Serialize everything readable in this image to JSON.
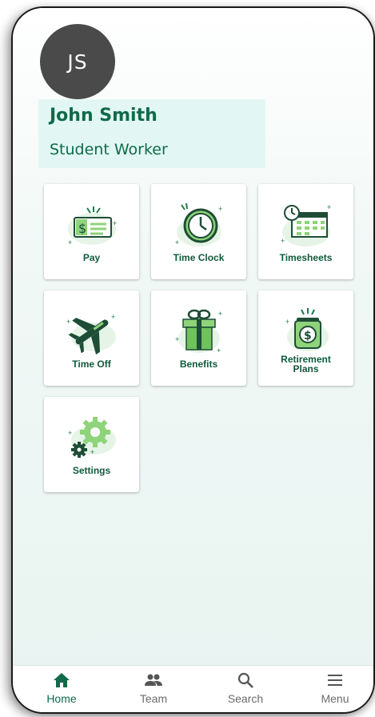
{
  "user": {
    "initials": "JS",
    "name": "John Smith",
    "role": "Student Worker"
  },
  "tiles": [
    {
      "label": "Pay",
      "icon": "pay-check-icon"
    },
    {
      "label": "Time Clock",
      "icon": "clock-icon"
    },
    {
      "label": "Timesheets",
      "icon": "timesheet-calendar-icon"
    },
    {
      "label": "Time Off",
      "icon": "airplane-icon"
    },
    {
      "label": "Benefits",
      "icon": "gift-icon"
    },
    {
      "label": "Retirement Plans",
      "icon": "money-jar-icon"
    },
    {
      "label": "Settings",
      "icon": "gears-icon"
    }
  ],
  "tabs": [
    {
      "label": "Home",
      "icon": "home-icon",
      "active": true
    },
    {
      "label": "Team",
      "icon": "people-icon",
      "active": false
    },
    {
      "label": "Search",
      "icon": "search-icon",
      "active": false
    },
    {
      "label": "Menu",
      "icon": "hamburger-menu-icon",
      "active": false
    }
  ],
  "colors": {
    "accent": "#0f6b49",
    "icon_light": "#8fd37a",
    "icon_dark": "#1e4d36",
    "highlight": "#e2f7f3",
    "avatar": "#4a4a4a"
  }
}
